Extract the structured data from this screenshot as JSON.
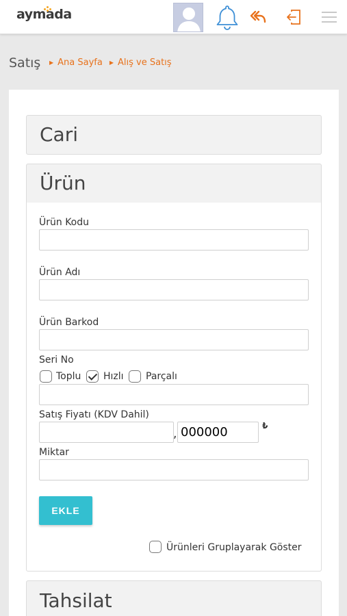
{
  "header": {
    "logo_text": "aymada",
    "icons": [
      "avatar",
      "bell-icon",
      "reply-icon",
      "logout-icon",
      "menu-icon"
    ],
    "accent": "#e8721c",
    "bell_color": "#3d8fd6"
  },
  "breadcrumb": {
    "title": "Satış",
    "items": [
      "Ana Sayfa",
      "Alış ve Satış"
    ]
  },
  "sections": {
    "cari": "Cari",
    "urun": "Ürün",
    "tahsilat": "Tahsilat"
  },
  "form": {
    "urun_kodu_label": "Ürün Kodu",
    "urun_kodu_value": "",
    "urun_adi_label": "Ürün Adı",
    "urun_adi_value": "",
    "urun_barkod_label": "Ürün Barkod",
    "urun_barkod_value": "",
    "seri_no_label": "Seri No",
    "seri_options": [
      {
        "label": "Toplu",
        "checked": false
      },
      {
        "label": "Hızlı",
        "checked": true
      },
      {
        "label": "Parçalı",
        "checked": false
      }
    ],
    "seri_no_value": "",
    "fiyat_label": "Satış Fiyatı (KDV Dahil)",
    "fiyat_integer": "",
    "fiyat_decimal": "000000",
    "decimal_separator": ",",
    "currency_symbol": "₺",
    "miktar_label": "Miktar",
    "miktar_value": "",
    "ekle_label": "EKLE",
    "group_label": "Ürünleri Gruplayarak Göster",
    "group_checked": false,
    "button_color": "#33bfd0"
  }
}
